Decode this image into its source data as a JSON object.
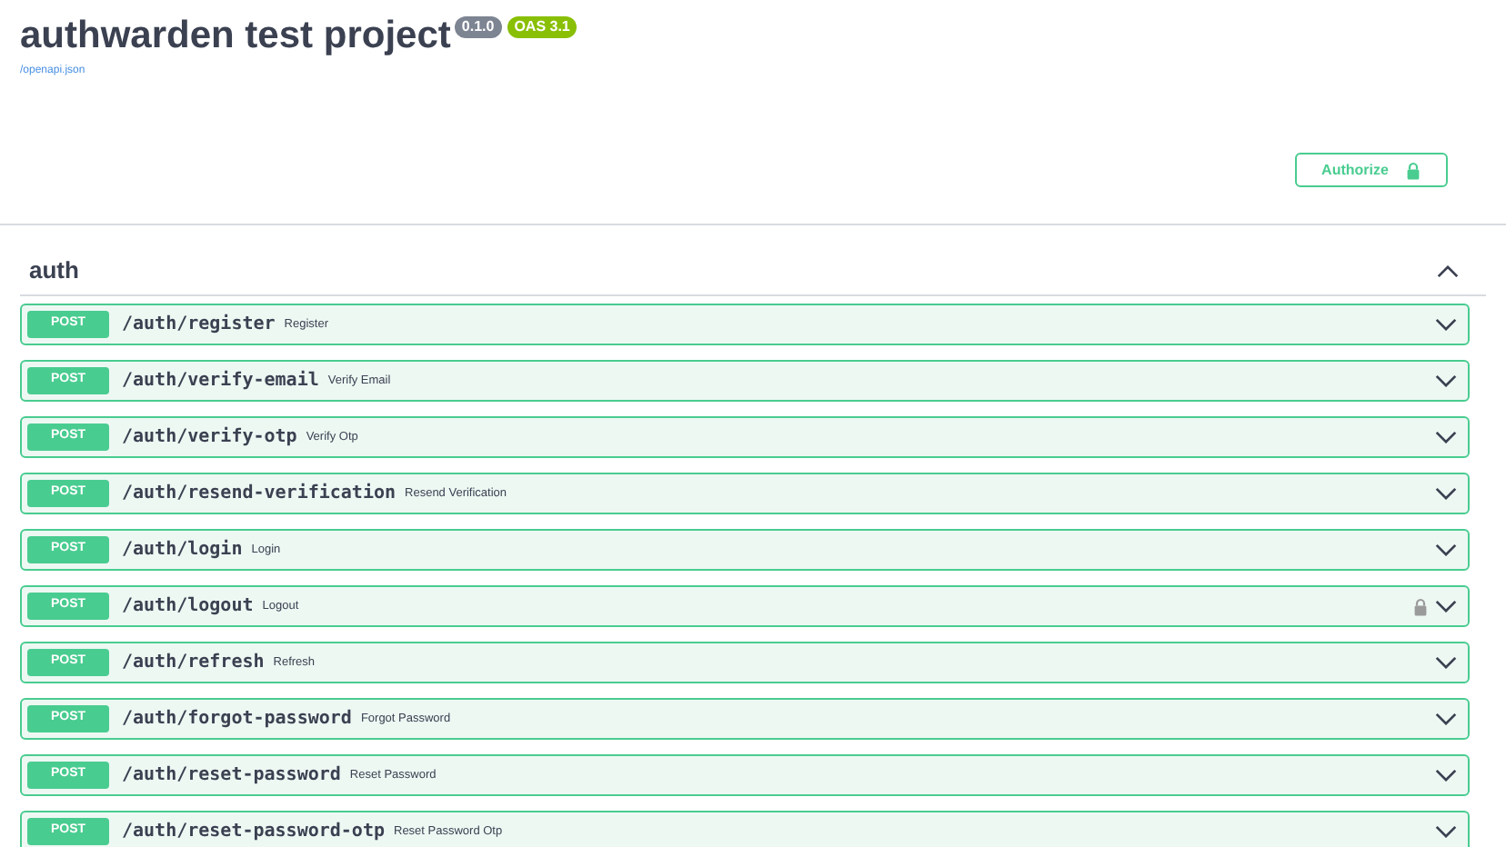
{
  "info": {
    "title": "authwarden test project",
    "version": "0.1.0",
    "oas": "OAS 3.1",
    "link": "/openapi.json"
  },
  "authorize": {
    "label": "Authorize"
  },
  "section": {
    "name": "auth",
    "expanded": true,
    "operations": [
      {
        "method": "POST",
        "path": "/auth/register",
        "summary": "Register",
        "locked": false
      },
      {
        "method": "POST",
        "path": "/auth/verify-email",
        "summary": "Verify Email",
        "locked": false
      },
      {
        "method": "POST",
        "path": "/auth/verify-otp",
        "summary": "Verify Otp",
        "locked": false
      },
      {
        "method": "POST",
        "path": "/auth/resend-verification",
        "summary": "Resend Verification",
        "locked": false
      },
      {
        "method": "POST",
        "path": "/auth/login",
        "summary": "Login",
        "locked": false
      },
      {
        "method": "POST",
        "path": "/auth/logout",
        "summary": "Logout",
        "locked": true
      },
      {
        "method": "POST",
        "path": "/auth/refresh",
        "summary": "Refresh",
        "locked": false
      },
      {
        "method": "POST",
        "path": "/auth/forgot-password",
        "summary": "Forgot Password",
        "locked": false
      },
      {
        "method": "POST",
        "path": "/auth/reset-password",
        "summary": "Reset Password",
        "locked": false
      },
      {
        "method": "POST",
        "path": "/auth/reset-password-otp",
        "summary": "Reset Password Otp",
        "locked": false
      }
    ]
  }
}
